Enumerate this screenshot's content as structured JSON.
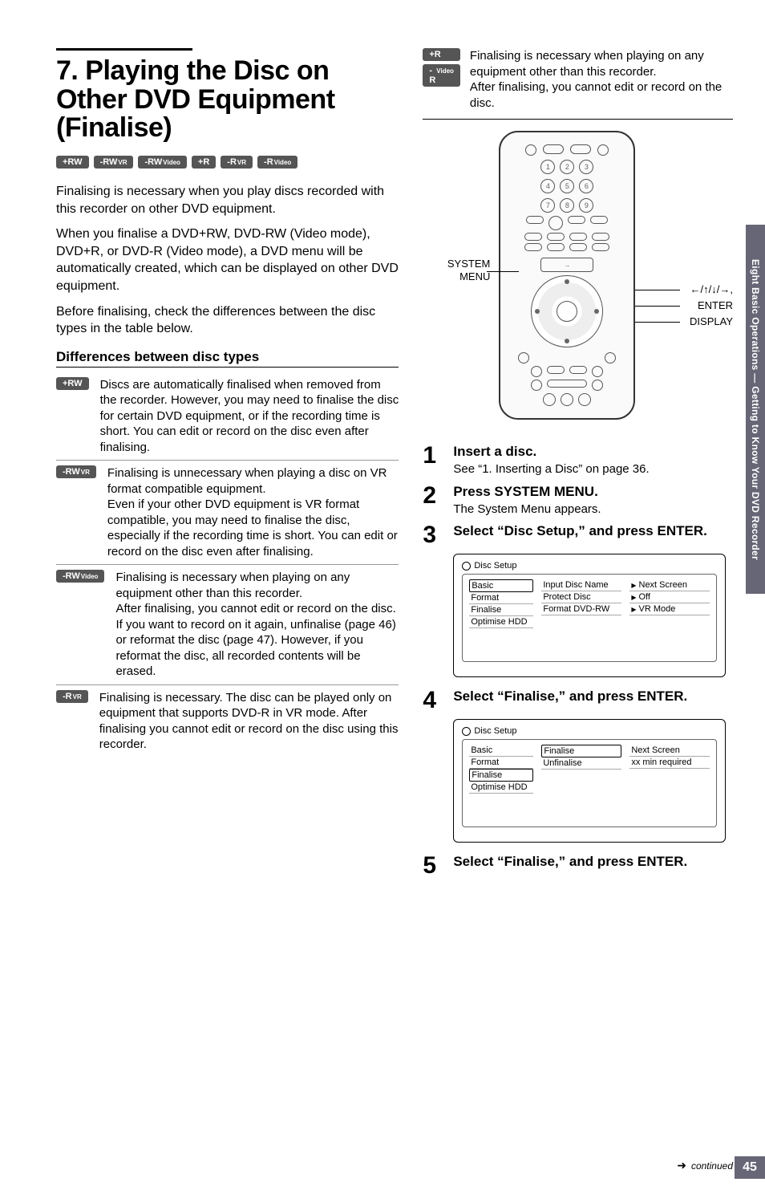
{
  "title": "7. Playing the Disc on Other DVD Equipment (Finalise)",
  "badges_under_title": [
    "+RW",
    "-RWVR",
    "-RWVideo",
    "+R",
    "-RVR",
    "-RVideo"
  ],
  "intro1": "Finalising is necessary when you play discs recorded with this recorder on other DVD equipment.",
  "intro2": "When you finalise a DVD+RW, DVD-RW (Video mode), DVD+R, or DVD-R (Video mode), a DVD menu will be automatically created, which can be displayed on other DVD equipment.",
  "intro3": "Before finalising, check the differences between the disc types in the table below.",
  "diff_heading": "Differences between disc types",
  "diffs": [
    {
      "badge": "+RW",
      "text": "Discs are automatically finalised when removed from the recorder. However, you may need to finalise the disc for certain DVD equipment, or if the recording time is short. You can edit or record on the disc even after finalising."
    },
    {
      "badge": "-RWVR",
      "text": "Finalising is unnecessary when playing a disc on VR format compatible equipment.\nEven if your other DVD equipment is VR format compatible, you may need to finalise the disc, especially if the recording time is short. You can edit or record on the disc even after finalising."
    },
    {
      "badge": "-RWVideo",
      "text": "Finalising is necessary when playing on any equipment other than this recorder.\nAfter finalising, you cannot edit or record on the disc. If you want to record on it again, unfinalise (page 46) or reformat the disc (page 47). However, if you reformat the disc, all recorded contents will be erased."
    },
    {
      "badge": "-RVR",
      "text": "Finalising is necessary. The disc can be played only on equipment that supports DVD-R in VR mode. After finalising you cannot edit or record on the disc using this recorder."
    }
  ],
  "topbox": {
    "badges": [
      "+R",
      "-RVideo"
    ],
    "text": "Finalising is necessary when playing on any equipment other than this recorder.\nAfter finalising, you cannot edit or record on the disc."
  },
  "remote_labels": {
    "system_menu": "SYSTEM\nMENU",
    "arrows": "←/↑/↓/→,",
    "enter": "ENTER",
    "display": "DISPLAY"
  },
  "steps": [
    {
      "num": "1",
      "head": "Insert a disc.",
      "body": "See “1. Inserting a Disc” on page 36."
    },
    {
      "num": "2",
      "head": "Press SYSTEM MENU.",
      "body": "The System Menu appears."
    },
    {
      "num": "3",
      "head": "Select “Disc Setup,” and press ENTER.",
      "body": ""
    },
    {
      "num": "4",
      "head": "Select “Finalise,” and press ENTER.",
      "body": ""
    },
    {
      "num": "5",
      "head": "Select “Finalise,” and press ENTER.",
      "body": ""
    }
  ],
  "setup1": {
    "title": "Disc Setup",
    "left": [
      "Basic",
      "Format",
      "Finalise",
      "Optimise HDD"
    ],
    "active": "Basic",
    "mid": [
      "Input Disc Name",
      "Protect Disc",
      "Format DVD-RW"
    ],
    "right": [
      "Next Screen",
      "Off",
      "VR Mode"
    ]
  },
  "setup2": {
    "title": "Disc Setup",
    "left": [
      "Basic",
      "Format",
      "Finalise",
      "Optimise HDD"
    ],
    "active": "Finalise",
    "mid": [
      "Finalise",
      "Unfinalise"
    ],
    "mid_active": "Finalise",
    "right": [
      "Next Screen",
      "xx min required"
    ]
  },
  "sidetab": "Eight Basic Operations — Getting to Know Your DVD Recorder",
  "continued": "continued",
  "pagenum": "45"
}
